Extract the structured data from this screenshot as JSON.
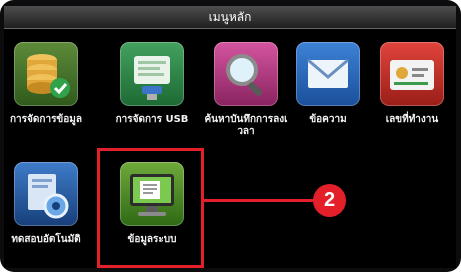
{
  "window": {
    "title": "เมนูหลัก"
  },
  "menu": {
    "items": [
      {
        "label": "การจัดการข้อมูล",
        "icon": "database-check-icon"
      },
      {
        "label": "การจัดการ USB",
        "icon": "usb-document-icon"
      },
      {
        "label": "ค้นหาบันทึกการลงเวลา",
        "icon": "magnifier-search-icon"
      },
      {
        "label": "ข้อความ",
        "icon": "envelope-icon"
      },
      {
        "label": "เลขที่ทำงาน",
        "icon": "id-card-icon"
      },
      {
        "label": "ทดสอบอัตโนมัติ",
        "icon": "autotest-icon"
      },
      {
        "label": "ข้อมูลระบบ",
        "icon": "system-info-monitor-icon"
      }
    ]
  },
  "annotation": {
    "badge_number": "2",
    "highlight_target": "ข้อมูลระบบ",
    "color": "#e3202a"
  }
}
